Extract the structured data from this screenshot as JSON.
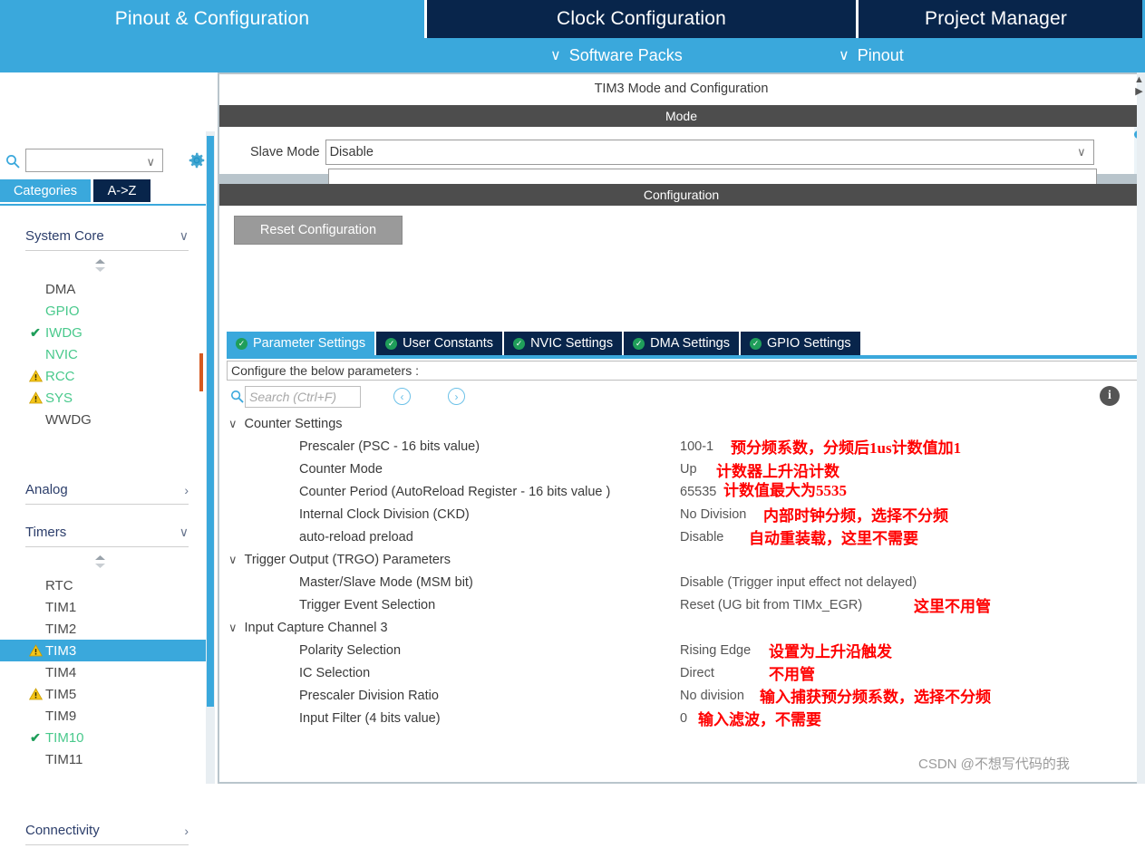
{
  "top_tabs": [
    {
      "label": "Pinout & Configuration",
      "active": true
    },
    {
      "label": "Clock Configuration",
      "active": false
    },
    {
      "label": "Project Manager",
      "active": false
    }
  ],
  "sub_bar": {
    "software_packs": "Software Packs",
    "pinout": "Pinout",
    "chevron": "∨"
  },
  "sidebar": {
    "search_placeholder": "",
    "gear_icon": "gear-icon",
    "tabs": [
      {
        "label": "Categories",
        "active": true
      },
      {
        "label": "A->Z",
        "active": false
      }
    ],
    "groups": [
      {
        "name": "System Core",
        "expanded": true,
        "chevron": "∨",
        "items": [
          {
            "label": "DMA",
            "state": "none",
            "color": "gray"
          },
          {
            "label": "GPIO",
            "state": "none",
            "color": "green"
          },
          {
            "label": "IWDG",
            "state": "check",
            "color": "green"
          },
          {
            "label": "NVIC",
            "state": "none",
            "color": "green"
          },
          {
            "label": "RCC",
            "state": "warning",
            "color": "green"
          },
          {
            "label": "SYS",
            "state": "warning",
            "color": "green"
          },
          {
            "label": "WWDG",
            "state": "none",
            "color": "gray"
          }
        ]
      },
      {
        "name": "Analog",
        "expanded": false,
        "chevron": "›",
        "items": []
      },
      {
        "name": "Timers",
        "expanded": true,
        "chevron": "∨",
        "items": [
          {
            "label": "RTC",
            "state": "none",
            "color": "gray"
          },
          {
            "label": "TIM1",
            "state": "none",
            "color": "gray"
          },
          {
            "label": "TIM2",
            "state": "none",
            "color": "gray"
          },
          {
            "label": "TIM3",
            "state": "warning",
            "color": "gray",
            "selected": true
          },
          {
            "label": "TIM4",
            "state": "none",
            "color": "gray"
          },
          {
            "label": "TIM5",
            "state": "warning",
            "color": "gray"
          },
          {
            "label": "TIM9",
            "state": "none",
            "color": "gray"
          },
          {
            "label": "TIM10",
            "state": "check",
            "color": "green"
          },
          {
            "label": "TIM11",
            "state": "none",
            "color": "gray"
          }
        ]
      },
      {
        "name": "Connectivity",
        "expanded": false,
        "chevron": "›",
        "items": []
      }
    ]
  },
  "main": {
    "title": "TIM3 Mode and Configuration",
    "mode_header": "Mode",
    "slave_mode_label": "Slave Mode",
    "slave_mode_value": "Disable",
    "configuration_header": "Configuration",
    "reset_button": "Reset Configuration",
    "tabs": [
      {
        "label": "Parameter Settings",
        "active": true
      },
      {
        "label": "User Constants",
        "active": false
      },
      {
        "label": "NVIC Settings",
        "active": false
      },
      {
        "label": "DMA Settings",
        "active": false
      },
      {
        "label": "GPIO Settings",
        "active": false
      }
    ],
    "configure_note": "Configure the below parameters :",
    "search_placeholder": "Search (Ctrl+F)",
    "nav_prev": "‹",
    "nav_next": "›",
    "info_icon": "info-icon"
  },
  "parameters": [
    {
      "kind": "group",
      "label": "Counter Settings",
      "chevron": "∨"
    },
    {
      "kind": "param",
      "label": "Prescaler (PSC - 16 bits value)",
      "value": "100-1",
      "annotation": "预分频系数，分频后1us计数值加1"
    },
    {
      "kind": "param",
      "label": "Counter Mode",
      "value": "Up",
      "annotation": "计数器上升沿计数"
    },
    {
      "kind": "param",
      "label": "Counter Period (AutoReload Register - 16 bits value )",
      "value": "65535",
      "annotation": "计数值最大为5535"
    },
    {
      "kind": "param",
      "label": "Internal Clock Division (CKD)",
      "value": "No Division",
      "annotation": "内部时钟分频，选择不分频"
    },
    {
      "kind": "param",
      "label": "auto-reload preload",
      "value": "Disable",
      "annotation": "自动重装载，这里不需要"
    },
    {
      "kind": "group",
      "label": "Trigger Output (TRGO) Parameters",
      "chevron": "∨"
    },
    {
      "kind": "param",
      "label": "Master/Slave Mode (MSM bit)",
      "value": "Disable (Trigger input effect not delayed)",
      "annotation": ""
    },
    {
      "kind": "param",
      "label": "Trigger Event Selection",
      "value": "Reset (UG bit from TIMx_EGR)",
      "annotation": "这里不用管"
    },
    {
      "kind": "group",
      "label": "Input Capture Channel 3",
      "chevron": "∨"
    },
    {
      "kind": "param",
      "label": "Polarity Selection",
      "value": "Rising Edge",
      "annotation": "设置为上升沿触发"
    },
    {
      "kind": "param",
      "label": "IC Selection",
      "value": "Direct",
      "annotation": "不用管"
    },
    {
      "kind": "param",
      "label": "Prescaler Division Ratio",
      "value": "No division",
      "annotation": "输入捕获预分频系数，选择不分频"
    },
    {
      "kind": "param",
      "label": "Input Filter (4 bits value)",
      "value": "0",
      "annotation": "输入滤波，不需要"
    }
  ],
  "watermark": "CSDN @不想写代码的我",
  "colors": {
    "accent_blue": "#3aa8dc",
    "dark_navy": "#08254b",
    "annotation_red": "#ff0000",
    "warning_yellow": "#f5c518",
    "check_green": "#1f9e5a",
    "panel_gray": "#b9c5cc"
  }
}
